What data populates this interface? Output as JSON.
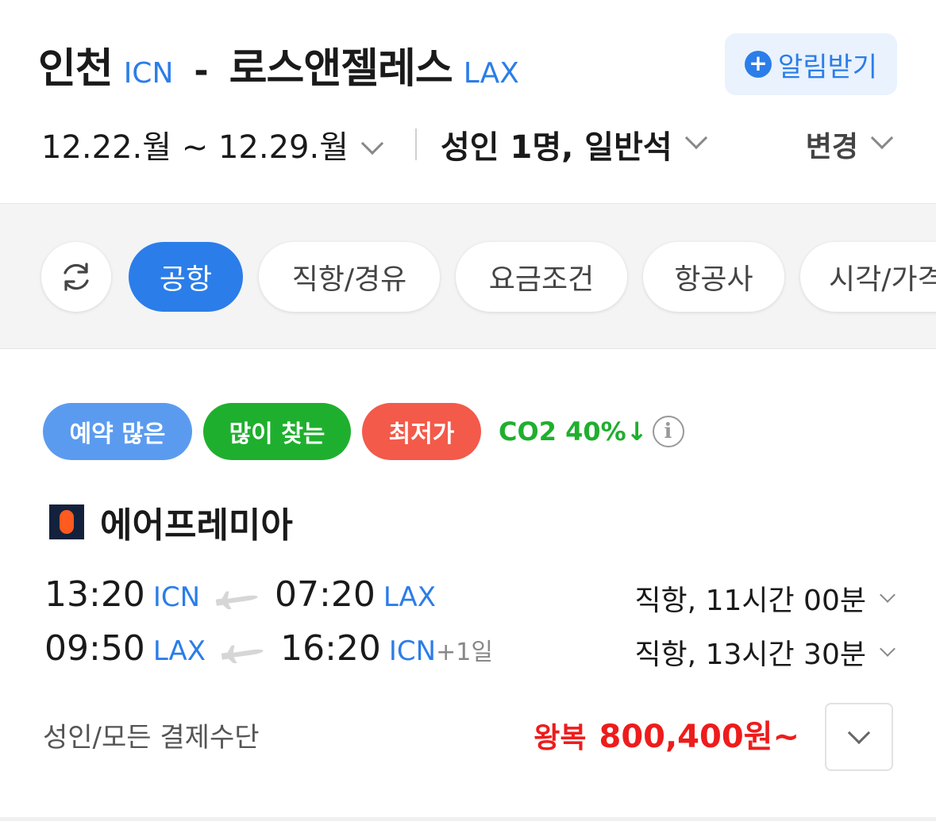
{
  "header": {
    "origin_city": "인천",
    "origin_code": "ICN",
    "separator": "-",
    "dest_city": "로스앤젤레스",
    "dest_code": "LAX",
    "alarm_label": "알림받기",
    "dates": "12.22.월 ~ 12.29.월",
    "passengers": "성인 1명, 일반석",
    "change_label": "변경"
  },
  "filters": {
    "refresh_icon": "refresh-icon",
    "items": [
      {
        "label": "공항",
        "active": true
      },
      {
        "label": "직항/경유",
        "active": false
      },
      {
        "label": "요금조건",
        "active": false
      },
      {
        "label": "항공사",
        "active": false
      },
      {
        "label": "시각/가격",
        "active": false
      }
    ]
  },
  "result": {
    "badges": [
      "예약 많은",
      "많이 찾는",
      "최저가"
    ],
    "co2": "CO2 40%↓",
    "info_icon": "i",
    "airline_name": "에어프레미아",
    "legs": [
      {
        "dep_time": "13:20",
        "dep_code": "ICN",
        "arr_time": "07:20",
        "arr_code": "LAX",
        "plus_day": "",
        "info": "직항, 11시간 00분"
      },
      {
        "dep_time": "09:50",
        "dep_code": "LAX",
        "arr_time": "16:20",
        "arr_code": "ICN",
        "plus_day": "+1일",
        "info": "직항, 13시간 30분"
      }
    ],
    "payment_label": "성인/모든 결제수단",
    "price_label": "왕복",
    "price_amount": "800,400원~"
  },
  "colors": {
    "accent": "#2b7de9",
    "badge_blue": "#5b9bef",
    "badge_green": "#1faf2e",
    "badge_red": "#f35a4a",
    "price": "#ee1c1c",
    "highlight": "#fff9c4"
  }
}
